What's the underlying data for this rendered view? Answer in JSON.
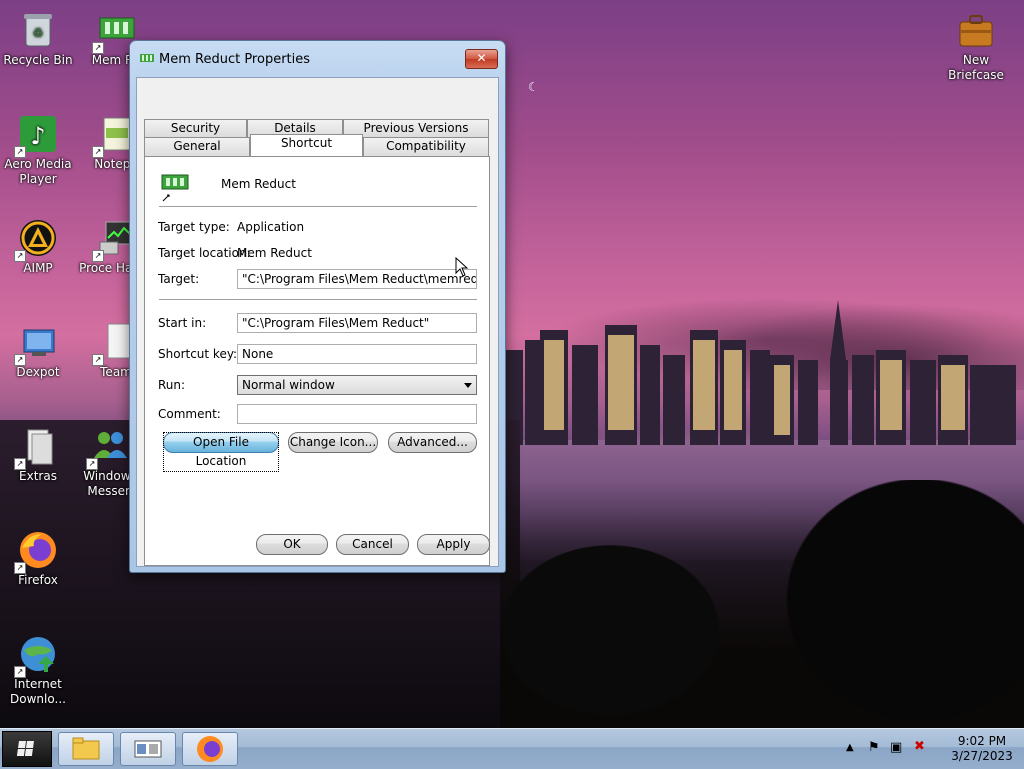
{
  "desktop": {
    "icons": [
      {
        "label": "Recycle Bin"
      },
      {
        "label": "Mem Re"
      },
      {
        "label": "New Briefcase"
      },
      {
        "label": "Aero Media Player"
      },
      {
        "label": "Notepa"
      },
      {
        "label": "AIMP"
      },
      {
        "label": "Proce Hacke"
      },
      {
        "label": "Dexpot"
      },
      {
        "label": "Team"
      },
      {
        "label": "Extras"
      },
      {
        "label": "Windows Messen"
      },
      {
        "label": "Firefox"
      },
      {
        "label": "Internet Downlo..."
      }
    ]
  },
  "window": {
    "title": "Mem Reduct Properties",
    "close_label": "✕",
    "tabs_row1": [
      "Security",
      "Details",
      "Previous Versions"
    ],
    "tabs_row2": [
      "General",
      "Shortcut",
      "Compatibility"
    ],
    "active_tab": "Shortcut",
    "app_name": "Mem Reduct",
    "fields": {
      "target_type_label": "Target type:",
      "target_type_value": "Application",
      "target_location_label": "Target location:",
      "target_location_value": "Mem Reduct",
      "target_label": "Target:",
      "target_value": "\"C:\\Program Files\\Mem Reduct\\memreduct.exe\"",
      "start_in_label": "Start in:",
      "start_in_value": "\"C:\\Program Files\\Mem Reduct\"",
      "shortcut_key_label": "Shortcut key:",
      "shortcut_key_value": "None",
      "run_label": "Run:",
      "run_value": "Normal window",
      "comment_label": "Comment:",
      "comment_value": ""
    },
    "buttons": {
      "open_file_location": "Open File Location",
      "change_icon": "Change Icon...",
      "advanced": "Advanced...",
      "ok": "OK",
      "cancel": "Cancel",
      "apply": "Apply"
    }
  },
  "taskbar": {
    "time": "9:02 PM",
    "date": "3/27/2023"
  },
  "colors": {
    "accent_focus": "#98d1ef",
    "close_red": "#c03a22"
  }
}
